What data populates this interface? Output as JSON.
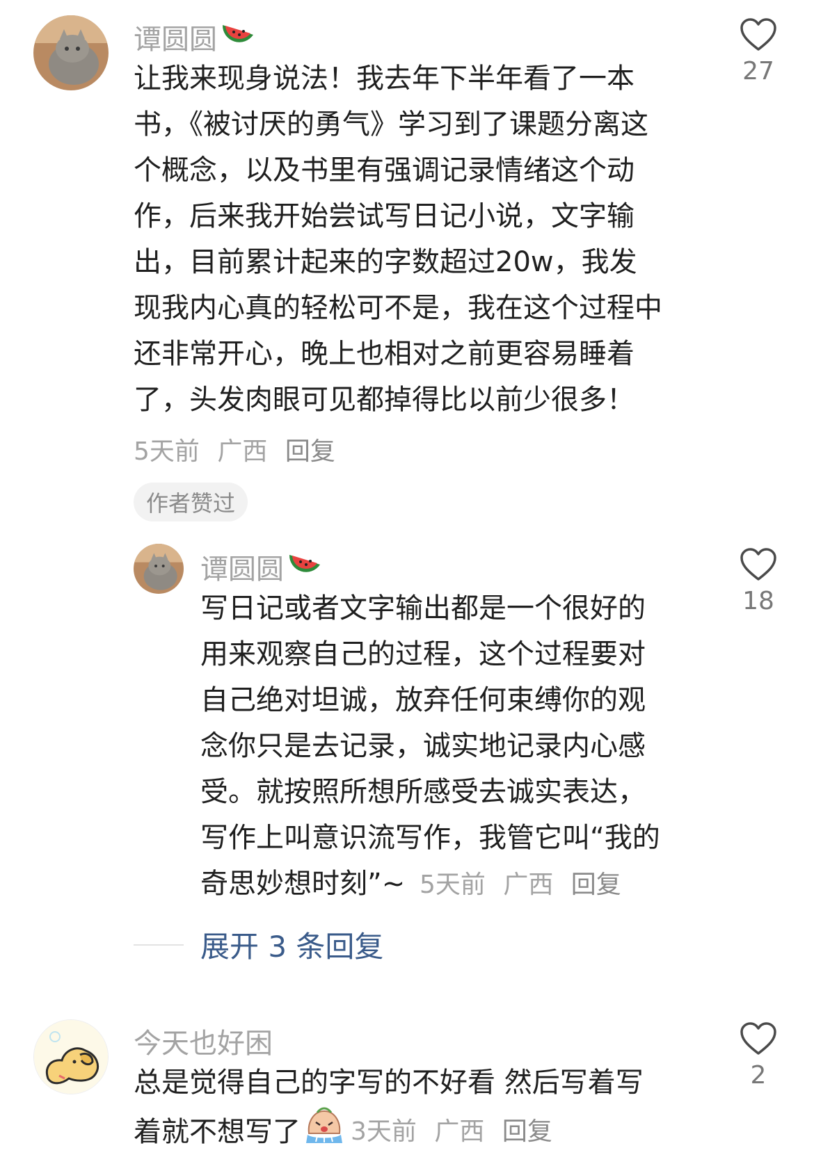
{
  "comments": [
    {
      "username": "谭圆圆",
      "username_emoji": "watermelon-icon",
      "lines": [
        "让我来现身说法！我去年下半年看了一本",
        "书，《被讨厌的勇气》学习到了课题分离这",
        "个概念，以及书里有强调记录情绪这个动",
        "作，后来我开始尝试写日记小说，文字输",
        "出，目前累计起来的字数超过20w，我发",
        "现我内心真的轻松可不是，我在这个过程中",
        "还非常开心，晚上也相对之前更容易睡着",
        "了，头发肉眼可见都掉得比以前少很多！"
      ],
      "time": "5天前",
      "location": "广西",
      "reply_label": "回复",
      "likes": "27",
      "author_badge": "作者赞过"
    },
    {
      "username": "谭圆圆",
      "username_emoji": "watermelon-icon",
      "lines": [
        "写日记或者文字输出都是一个很好的",
        "用来观察自己的过程，这个过程要对",
        "自己绝对坦诚，放弃任何束缚你的观",
        "念你只是去记录，诚实地记录内心感",
        "受。就按照所想所感受去诚实表达，",
        "写作上叫意识流写作，我管它叫“我的",
        "奇思妙想时刻”~"
      ],
      "time": "5天前",
      "location": "广西",
      "reply_label": "回复",
      "likes": "18"
    },
    {
      "username": "今天也好困",
      "lines": [
        "总是觉得自己的字写的不好看 然后写着写",
        "着就不想写了"
      ],
      "inline_emoji": "crying-face-icon",
      "time": "3天前",
      "location": "广西",
      "reply_label": "回复",
      "likes": "2"
    }
  ],
  "expand_replies": "展开 3 条回复",
  "colors": {
    "meta": "#a3a3a3",
    "expand_link": "#3a5b8a",
    "badge_bg": "#f2f2f2"
  }
}
